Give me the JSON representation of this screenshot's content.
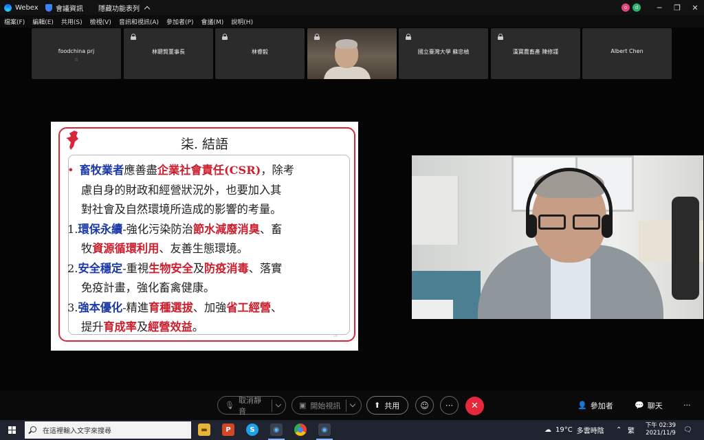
{
  "titlebar": {
    "app_name": "Webex",
    "meeting_info": "會議資訊",
    "hide_menu": "隱藏功能表列",
    "avatar1": "o",
    "avatar2": "d"
  },
  "menu": [
    "檔案(F)",
    "編輯(E)",
    "共用(S)",
    "檢視(V)",
    "音訊和視訊(A)",
    "參加者(P)",
    "會議(M)",
    "說明(H)"
  ],
  "participants": [
    {
      "name": "foodchina prj",
      "sub": "☆"
    },
    {
      "name": "林聰賢董事長"
    },
    {
      "name": "林睿毅"
    },
    {
      "name": ""
    },
    {
      "name": "國立臺灣大學 蘇忠楨"
    },
    {
      "name": "漢寶農畜產 陳修謹"
    },
    {
      "name": "Albert Chen"
    }
  ],
  "slide": {
    "title": "柒. 結語",
    "page": "18",
    "lines": [
      [
        "•",
        "畜牧業者",
        "應善盡",
        "企業社會責任(CSR)",
        "，除考"
      ],
      [
        "",
        "",
        "慮自身的財政和經營狀況外，也要加入其",
        "",
        ""
      ],
      [
        "",
        "",
        "對社會及自然環境所造成的影響的考量。",
        "",
        ""
      ],
      [
        "1.",
        "環保永續",
        "-強化污染防治",
        "節水減廢消臭",
        "、畜"
      ],
      [
        "",
        "",
        "牧",
        "資源循環利用",
        "、友善生態環境。"
      ],
      [
        "2.",
        "安全穩定",
        "-重視",
        "生物安全",
        "及"
      ],
      [
        "",
        "",
        "免疫計畫，強化畜禽健康。",
        "",
        ""
      ],
      [
        "3.",
        "強本優化",
        "-精進",
        "育種選拔",
        "、加強"
      ],
      [
        "",
        "",
        "提升",
        "育成率",
        "及"
      ]
    ],
    "line6_tail": [
      "防疫消毒",
      "、落實"
    ],
    "line8_tail": [
      "省工經營",
      "、"
    ],
    "line9_tail": [
      "經營效益",
      "。"
    ]
  },
  "controls": {
    "mute": "取消靜音",
    "video": "開始視訊",
    "share": "共用",
    "participants": "參加者",
    "chat": "聊天",
    "more": "···"
  },
  "taskbar": {
    "search_placeholder": "在這裡輸入文字來搜尋",
    "temperature": "19°C",
    "weather": "多雲時陰",
    "ime": "繁",
    "time": "下午 02:39",
    "date": "2021/11/9"
  },
  "colors": {
    "accent_blue": "#1c3aa8",
    "accent_red": "#cc1f2e",
    "end_call": "#e5283b"
  }
}
